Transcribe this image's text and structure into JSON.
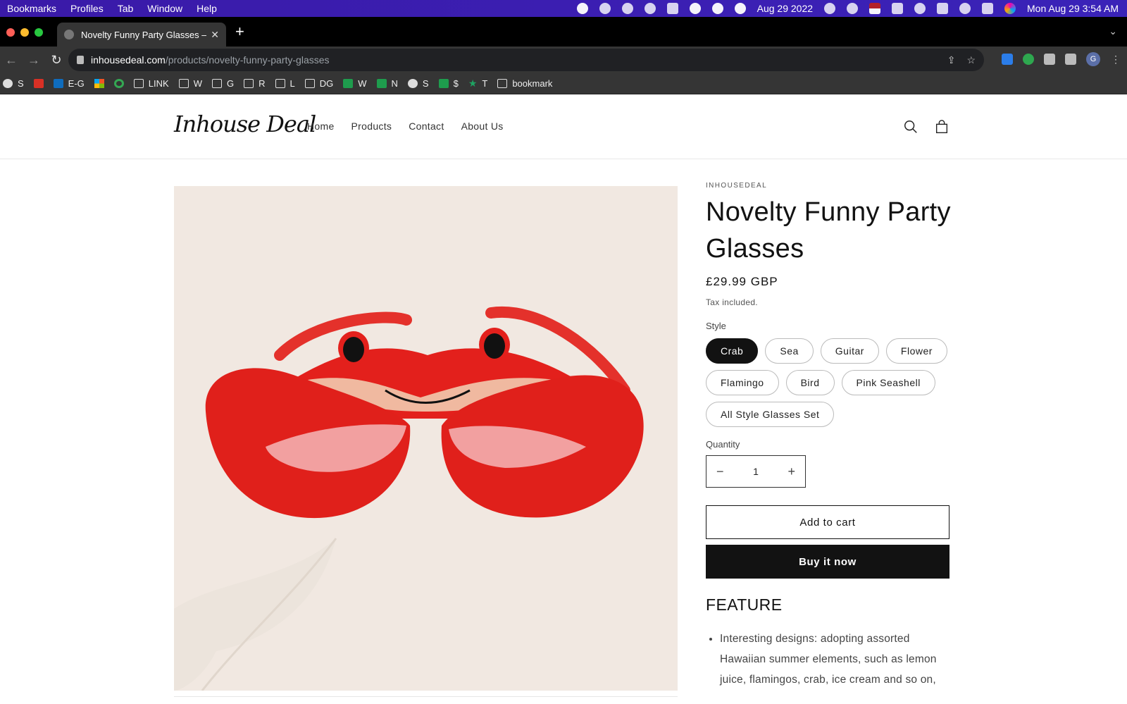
{
  "menubar": {
    "menus": [
      "Bookmarks",
      "Profiles",
      "Tab",
      "Window",
      "Help"
    ],
    "date_short": "Aug 29 2022",
    "clock": "Mon Aug 29  3:54 AM"
  },
  "browser": {
    "tab_title": "Novelty Funny Party Glasses –",
    "url_host": "inhousedeal.com",
    "url_path": "/products/novelty-funny-party-glasses",
    "profile_initial": "G",
    "bookmarks": [
      {
        "label": "S",
        "icon": "globe"
      },
      {
        "label": "",
        "icon": "gmail"
      },
      {
        "label": "E-G",
        "icon": "outlook"
      },
      {
        "label": "",
        "icon": "ms"
      },
      {
        "label": "",
        "icon": "g"
      },
      {
        "label": "LINK",
        "icon": "folder"
      },
      {
        "label": "W",
        "icon": "folder"
      },
      {
        "label": "G",
        "icon": "folder"
      },
      {
        "label": "R",
        "icon": "folder"
      },
      {
        "label": "L",
        "icon": "folder"
      },
      {
        "label": "DG",
        "icon": "folder"
      },
      {
        "label": "W",
        "icon": "sheet"
      },
      {
        "label": "N",
        "icon": "sheet"
      },
      {
        "label": "S",
        "icon": "globe"
      },
      {
        "label": "$",
        "icon": "sheet"
      },
      {
        "label": "T",
        "icon": "star"
      },
      {
        "label": "bookmark",
        "icon": "folder"
      }
    ]
  },
  "site": {
    "logo": "Inhouse Deal",
    "nav": [
      "Home",
      "Products",
      "Contact",
      "About Us"
    ]
  },
  "product": {
    "vendor": "INHOUSEDEAL",
    "title": "Novelty Funny Party Glasses",
    "price": "£29.99 GBP",
    "tax_note": "Tax included.",
    "style_label": "Style",
    "styles": [
      "Crab",
      "Sea",
      "Guitar",
      "Flower",
      "Flamingo",
      "Bird",
      "Pink Seashell",
      "All Style Glasses Set"
    ],
    "selected_style": "Crab",
    "quantity_label": "Quantity",
    "quantity": "1",
    "decrease_symbol": "−",
    "increase_symbol": "+",
    "add_to_cart": "Add to cart",
    "buy_now": "Buy it now",
    "feature_heading": "FEATURE",
    "feature_text": "Interesting designs: adopting assorted Hawaiian summer elements, such as lemon juice, flamingos, crab, ice cream and so on,"
  }
}
